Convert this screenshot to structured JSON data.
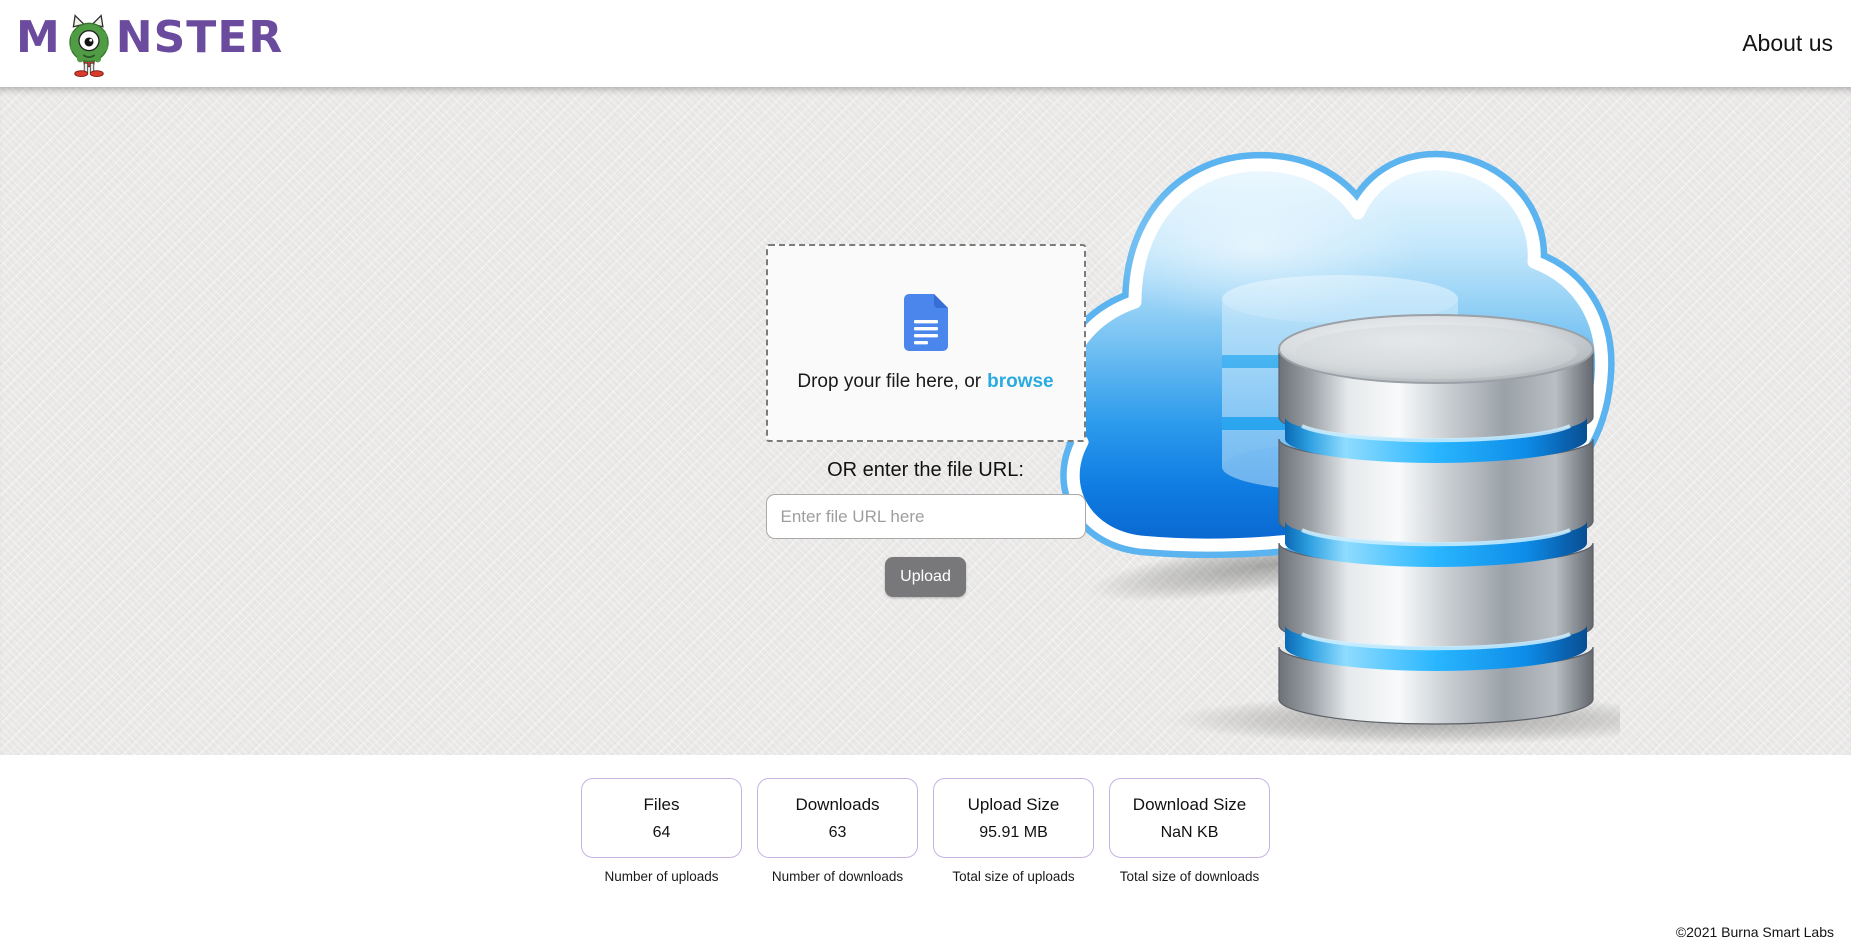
{
  "header": {
    "brand": {
      "first_letter": "M",
      "rest": "NSTER"
    },
    "about_label": "About us"
  },
  "uploader": {
    "drop_text": "Drop your file here, or",
    "browse_label": "browse",
    "url_prompt": "OR enter the file URL:",
    "url_placeholder": "Enter file URL here",
    "upload_label": "Upload"
  },
  "stats": {
    "cards": [
      {
        "title": "Files",
        "value": "64",
        "caption": "Number of uploads"
      },
      {
        "title": "Downloads",
        "value": "63",
        "caption": "Number of downloads"
      },
      {
        "title": "Upload Size",
        "value": "95.91 MB",
        "caption": "Total size of uploads"
      },
      {
        "title": "Download Size",
        "value": "NaN KB",
        "caption": "Total size of downloads"
      }
    ]
  },
  "footer": {
    "copyright": "©2021 Burna Smart Labs"
  },
  "icons": {
    "logo": "monster-icon",
    "dropzone": "document-icon",
    "illustration": "cloud-database-illustration"
  },
  "colors": {
    "brand_purple": "#6b4b9e",
    "browse_blue": "#29abe2",
    "card_border": "#c7b4e2",
    "button_gray": "#78787a",
    "cloud_blue": "#0d7ee2"
  }
}
